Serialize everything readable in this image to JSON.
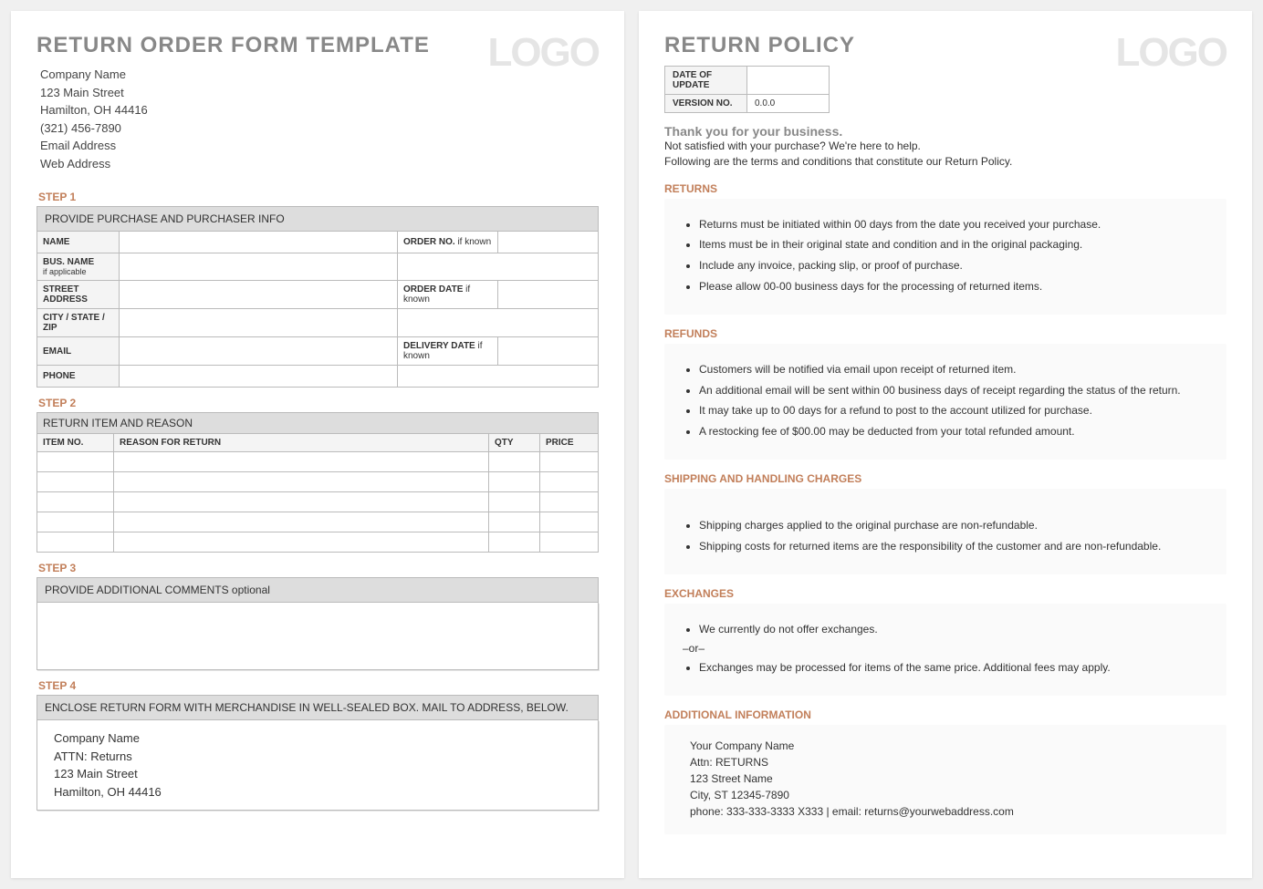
{
  "left": {
    "title": "RETURN ORDER FORM TEMPLATE",
    "company": {
      "name": "Company Name",
      "street": "123 Main Street",
      "citystate": "Hamilton, OH 44416",
      "phone": "(321) 456-7890",
      "email": "Email Address",
      "web": "Web Address"
    },
    "logo": "LOGO",
    "step1": {
      "label": "STEP 1",
      "banner": "PROVIDE PURCHASE AND PURCHASER INFO",
      "rows": {
        "name": "NAME",
        "bus": "BUS. NAME",
        "bus_sub": "if applicable",
        "street": "STREET ADDRESS",
        "csz": "CITY / STATE / ZIP",
        "email": "EMAIL",
        "phone": "PHONE",
        "order_no": "ORDER NO.",
        "order_no_hint": "  if known",
        "order_date": "ORDER DATE",
        "order_date_hint": "  if known",
        "delivery_date": "DELIVERY DATE",
        "delivery_date_hint": "  if known"
      }
    },
    "step2": {
      "label": "STEP 2",
      "banner": "RETURN ITEM AND REASON",
      "cols": {
        "item": "ITEM NO.",
        "reason": "REASON FOR RETURN",
        "qty": "QTY",
        "price": "PRICE"
      }
    },
    "step3": {
      "label": "STEP 3",
      "banner": "PROVIDE ADDITIONAL COMMENTS  optional"
    },
    "step4": {
      "label": "STEP 4",
      "banner": "ENCLOSE RETURN FORM WITH MERCHANDISE IN WELL-SEALED BOX.  MAIL TO ADDRESS, BELOW.",
      "mail": {
        "name": "Company Name",
        "attn": "ATTN: Returns",
        "street": "123 Main Street",
        "csz": "Hamilton, OH 44416"
      }
    }
  },
  "right": {
    "title": "RETURN POLICY",
    "logo": "LOGO",
    "meta": {
      "date_label": "DATE OF UPDATE",
      "date_value": "",
      "ver_label": "VERSION NO.",
      "ver_value": "0.0.0"
    },
    "thanks": "Thank you for your business.",
    "intro1": "Not satisfied with your purchase? We're here to help.",
    "intro2": "Following are the terms and conditions that constitute our Return Policy.",
    "sections": {
      "returns": {
        "title": "RETURNS",
        "items": [
          "Returns must be initiated within 00 days from the date you received your purchase.",
          "Items must be in their original state and condition and in the original packaging.",
          "Include any invoice, packing slip, or proof of purchase.",
          "Please allow 00-00 business days for the processing of returned items."
        ]
      },
      "refunds": {
        "title": "REFUNDS",
        "items": [
          "Customers will be notified via email upon receipt of returned item.",
          "An additional email will be sent within 00 business days of receipt regarding the status of the return.",
          "It may take up to 00 days for a refund to post to the account utilized for purchase.",
          "A restocking fee of $00.00 may be deducted from your total refunded amount."
        ]
      },
      "shipping": {
        "title": "SHIPPING AND HANDLING CHARGES",
        "items": [
          "Shipping charges applied to the original purchase are non-refundable.",
          "Shipping costs for returned items are the responsibility of the customer and are non-refundable."
        ]
      },
      "exchanges": {
        "title": "EXCHANGES",
        "item1": "We currently do not offer exchanges.",
        "or": "–or–",
        "item2": "Exchanges may be processed for items of the same price. Additional fees may apply."
      },
      "addl": {
        "title": "ADDITIONAL INFORMATION",
        "lines": [
          "Your Company Name",
          "Attn: RETURNS",
          "123 Street Name",
          "City, ST  12345-7890",
          "phone: 333-333-3333 X333    |    email: returns@yourwebaddress.com"
        ]
      }
    }
  }
}
